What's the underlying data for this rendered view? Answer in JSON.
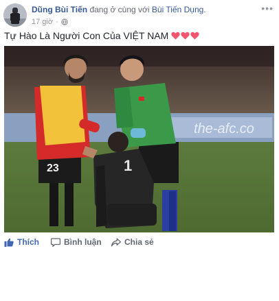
{
  "header": {
    "author": "Dũng Bùi Tiến",
    "with_text": " đang ở cùng với ",
    "tagged": "Bùi Tiến Dụng",
    "time": "17 giờ",
    "separator": "·"
  },
  "post": {
    "caption": "Tự Hào Là Người Con Của VIỆT NAM"
  },
  "actions": {
    "like": "Thích",
    "comment": "Bình luận",
    "share": "Chia sẻ"
  },
  "colors": {
    "link": "#365899",
    "like_active": "#4267b2",
    "heart": "#f2566e"
  }
}
